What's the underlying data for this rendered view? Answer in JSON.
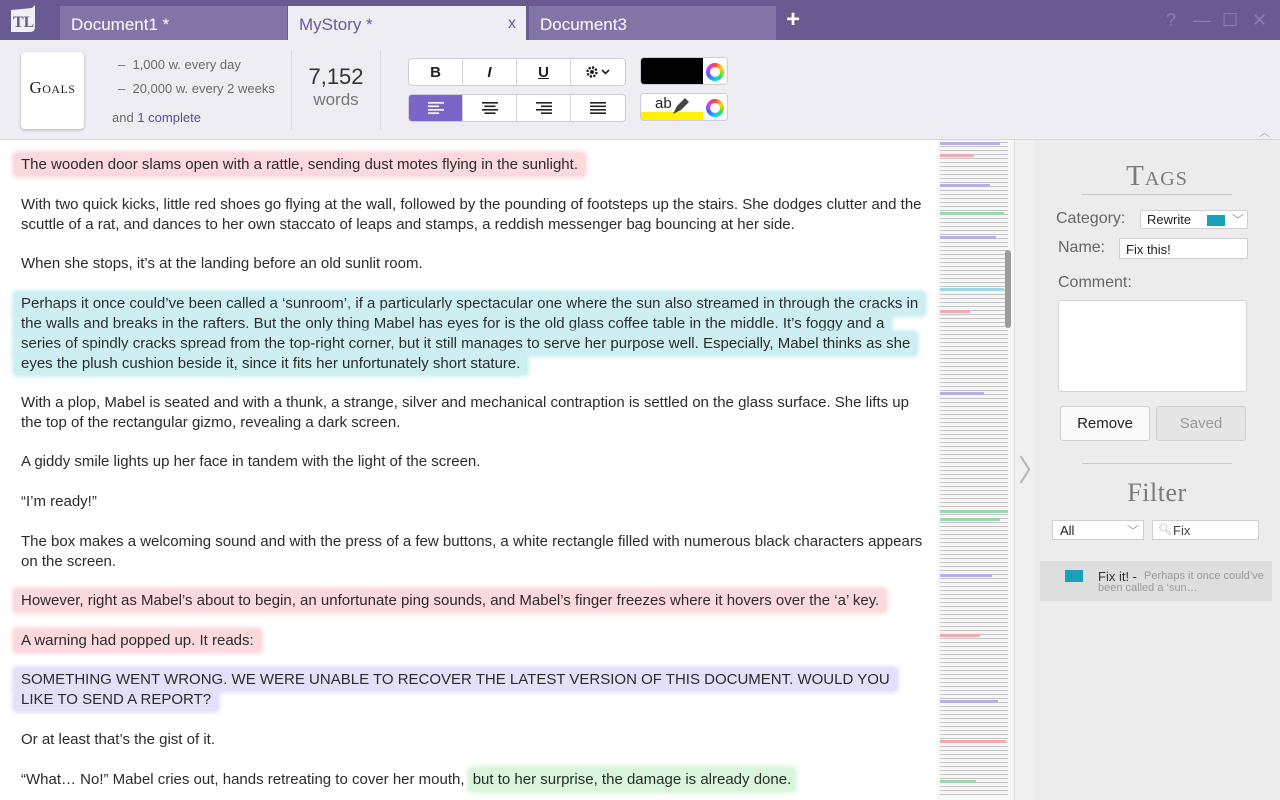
{
  "app": {
    "logo_text": "TL"
  },
  "tabs": [
    {
      "label": "Document1 *",
      "active": false
    },
    {
      "label": "MyStory *",
      "active": true,
      "close": "x"
    },
    {
      "label": "Document3",
      "active": false
    }
  ],
  "add_tab": "+",
  "window_controls": {
    "help": "?",
    "minimize": "—",
    "maximize": "☐",
    "close": "✕"
  },
  "goals": {
    "card_label": "Goals",
    "items": [
      "1,000 w. every day",
      "20,000 w. every 2 weeks"
    ],
    "bullet": "–",
    "complete_prefix": "and",
    "complete_link": "1 complete"
  },
  "wordcount": {
    "value": "7,152",
    "label": "words"
  },
  "format": {
    "bold": "B",
    "italic": "I",
    "underline": "U",
    "settings_icon": "gear-icon",
    "align_left_active": true,
    "text_color": "#000000",
    "highlight_label": "ab",
    "highlight_color": "#fff200"
  },
  "paragraphs": [
    {
      "segments": [
        {
          "text": "The wooden door slams open with a rattle, sending dust motes flying in the sunlight.",
          "hl": "red"
        }
      ]
    },
    {
      "segments": [
        {
          "text": "With two quick kicks, little red shoes go flying at the wall, followed by the pounding of footsteps up the stairs. She dodges clutter and the scuttle of a rat, and dances to her own staccato of leaps and stamps, a reddish messenger bag bouncing at her side.",
          "hl": ""
        }
      ]
    },
    {
      "segments": [
        {
          "text": "When she stops, it’s at the landing before an old sunlit room.",
          "hl": ""
        }
      ]
    },
    {
      "segments": [
        {
          "text": "Perhaps it once could’ve been called a ‘sunroom’, if a particularly spectacular one where the sun also streamed in through the cracks in the walls and breaks in the rafters. But the only thing Mabel has eyes for is the old glass coffee table in the middle. It’s foggy and a series of spindly cracks spread from the top-right corner, but it still manages to serve her purpose well. Especially, Mabel thinks as she eyes the plush cushion beside it, since it fits her unfortunately short stature.",
          "hl": "blue"
        }
      ]
    },
    {
      "segments": [
        {
          "text": "With a plop, Mabel is seated and with a thunk, a strange, silver and mechanical contraption is settled on the glass surface. She lifts up the top of the rectangular gizmo, revealing a dark screen.",
          "hl": ""
        }
      ]
    },
    {
      "segments": [
        {
          "text": "A giddy smile lights up her face in tandem with the light of the screen.",
          "hl": ""
        }
      ]
    },
    {
      "segments": [
        {
          "text": "“I’m ready!”",
          "hl": ""
        }
      ]
    },
    {
      "segments": [
        {
          "text": "The box makes a welcoming sound and with the press of a few buttons, a white rectangle filled with numerous black characters appears on the screen.",
          "hl": ""
        }
      ]
    },
    {
      "segments": [
        {
          "text": "However, right as Mabel’s about to begin, an unfortunate ping sounds, and Mabel’s finger freezes where it hovers over the ‘a’ key.",
          "hl": "red"
        }
      ]
    },
    {
      "segments": [
        {
          "text": "A warning had popped up. It reads:",
          "hl": "red"
        }
      ]
    },
    {
      "segments": [
        {
          "text": "SOMETHING WENT WRONG. WE WERE UNABLE TO RECOVER THE LATEST VERSION OF THIS DOCUMENT. WOULD YOU LIKE TO SEND A REPORT?",
          "hl": "purple"
        }
      ]
    },
    {
      "segments": [
        {
          "text": "Or at least that’s the gist of it.",
          "hl": ""
        }
      ]
    },
    {
      "segments": [
        {
          "text": "“What… No!” Mabel cries out, hands retreating to cover her mouth, ",
          "hl": ""
        },
        {
          "text": "but to her surprise, the damage is already done.",
          "hl": "green"
        }
      ]
    }
  ],
  "highlight_colors": {
    "red": "#fcd9dd",
    "blue": "#cdeff2",
    "purple": "#e5e0fa",
    "green": "#d9f5dc"
  },
  "tags_panel": {
    "title": "Tags",
    "category_label": "Category:",
    "category_value": "Rewrite",
    "category_color": "#1aa0b8",
    "name_label": "Name:",
    "name_value": "Fix this!",
    "comment_label": "Comment:",
    "comment_value": "",
    "remove_label": "Remove",
    "saved_label": "Saved"
  },
  "filter_panel": {
    "title": "Filter",
    "select_value": "All",
    "search_value": "Fix",
    "results": [
      {
        "name": "Fix it! -",
        "snippet": "Perhaps it once could’ve been called a ‘sun…",
        "color": "#1aa0b8"
      }
    ]
  }
}
